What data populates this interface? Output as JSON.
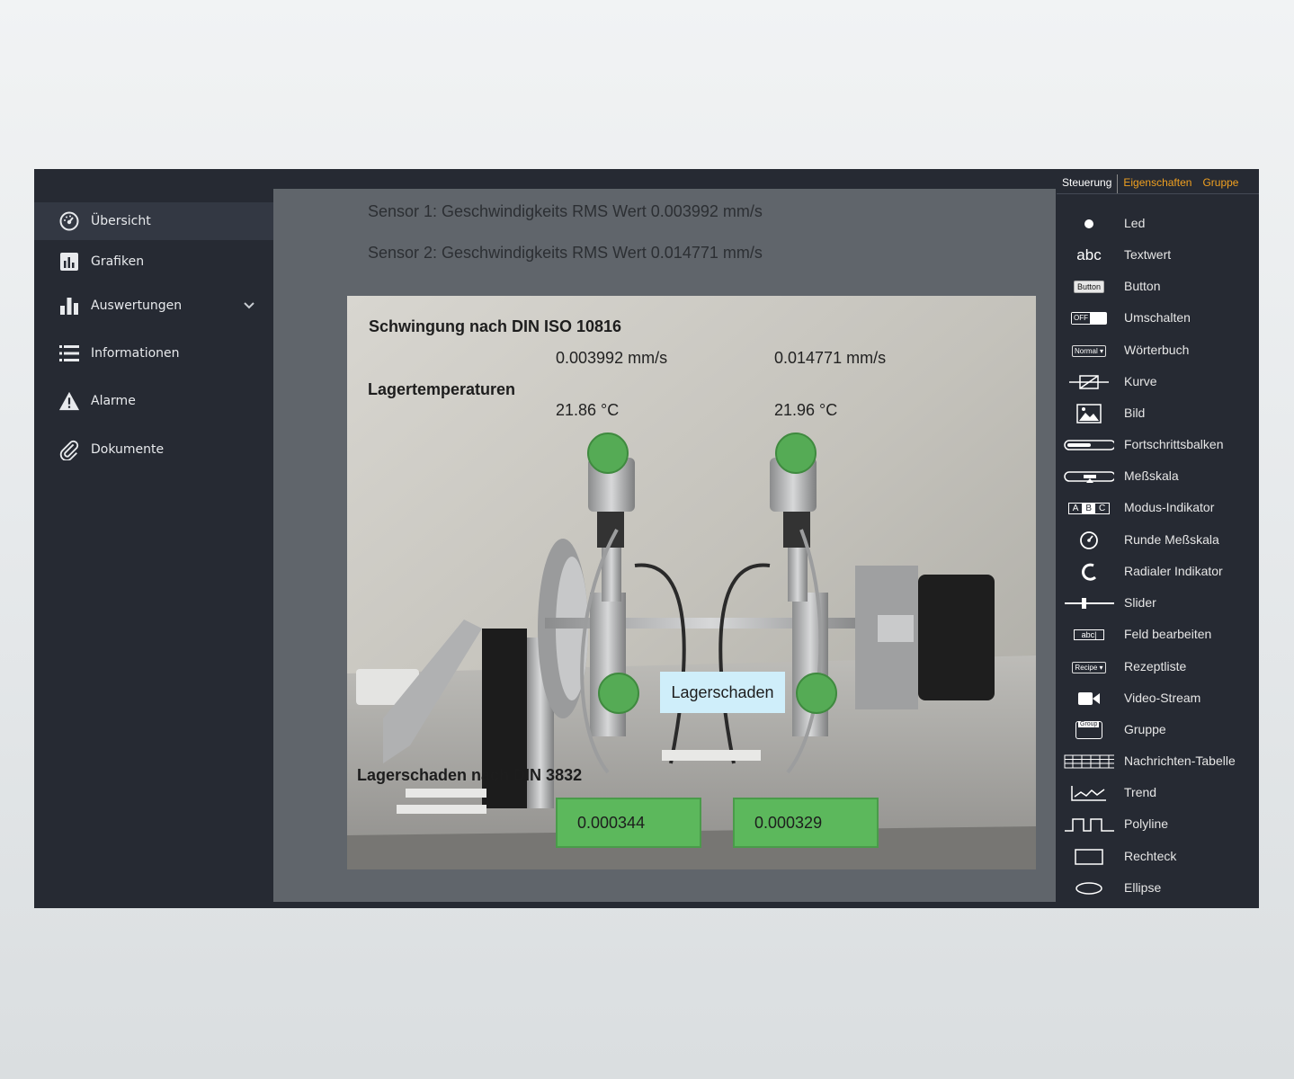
{
  "sidebar": {
    "items": [
      {
        "label": "Übersicht",
        "icon": "dashboard-icon",
        "active": true
      },
      {
        "label": "Grafiken",
        "icon": "chart-box-icon"
      },
      {
        "label": "Auswertungen",
        "icon": "bar-chart-icon",
        "expandable": true
      },
      {
        "label": "Informationen",
        "icon": "list-icon"
      },
      {
        "label": "Alarme",
        "icon": "warning-icon"
      },
      {
        "label": "Dokumente",
        "icon": "paperclip-icon"
      }
    ]
  },
  "main": {
    "sensor_lines": [
      "Sensor 1: Geschwindigkeits RMS Wert  0.003992 mm/s",
      "Sensor 2: Geschwindigkeits RMS Wert  0.014771 mm/s"
    ],
    "scene": {
      "heading_vibration": "Schwingung nach DIN ISO 10816",
      "vib_value_1": "0.003992 mm/s",
      "vib_value_2": "0.014771 mm/s",
      "heading_temp": "Lagertemperaturen",
      "temp_value_1": "21.86 °C",
      "temp_value_2": "21.96 °C",
      "alarm_label": "Lagerschaden",
      "heading_damage": "Lagerschaden nach DIN 3832",
      "damage_value_1": "0.000344",
      "damage_value_2": "0.000329",
      "led_color": "#55ab55"
    }
  },
  "panel": {
    "tabs": [
      "Steuerung",
      "Eigenschaften",
      "Gruppe"
    ],
    "active_tab": "Steuerung",
    "icon_texts": {
      "textwert": "abc",
      "button": "Button",
      "toggle": "OFF",
      "dictionary": "Normal",
      "mode_a": "A",
      "mode_b": "B",
      "mode_c": "C",
      "edit": "abc|",
      "recipe": "Recipe",
      "group": "Group"
    },
    "controls": [
      {
        "label": "Led",
        "icon": "led-icon"
      },
      {
        "label": "Textwert",
        "icon": "text-value-icon"
      },
      {
        "label": "Button",
        "icon": "button-icon"
      },
      {
        "label": "Umschalten",
        "icon": "toggle-icon"
      },
      {
        "label": "Wörterbuch",
        "icon": "dictionary-icon"
      },
      {
        "label": "Kurve",
        "icon": "curve-icon"
      },
      {
        "label": "Bild",
        "icon": "image-icon"
      },
      {
        "label": "Fortschrittsbalken",
        "icon": "progress-bar-icon"
      },
      {
        "label": "Meßskala",
        "icon": "gauge-scale-icon"
      },
      {
        "label": "Modus-Indikator",
        "icon": "mode-indicator-icon"
      },
      {
        "label": "Runde Meßskala",
        "icon": "round-gauge-icon"
      },
      {
        "label": "Radialer Indikator",
        "icon": "radial-indicator-icon"
      },
      {
        "label": "Slider",
        "icon": "slider-icon"
      },
      {
        "label": "Feld bearbeiten",
        "icon": "edit-field-icon"
      },
      {
        "label": "Rezeptliste",
        "icon": "recipe-list-icon"
      },
      {
        "label": "Video-Stream",
        "icon": "video-camera-icon"
      },
      {
        "label": "Gruppe",
        "icon": "group-icon"
      },
      {
        "label": "Nachrichten-Tabelle",
        "icon": "message-table-icon"
      },
      {
        "label": "Trend",
        "icon": "trend-icon"
      },
      {
        "label": "Polyline",
        "icon": "polyline-icon"
      },
      {
        "label": "Rechteck",
        "icon": "rectangle-icon"
      },
      {
        "label": "Ellipse",
        "icon": "ellipse-icon"
      }
    ]
  }
}
